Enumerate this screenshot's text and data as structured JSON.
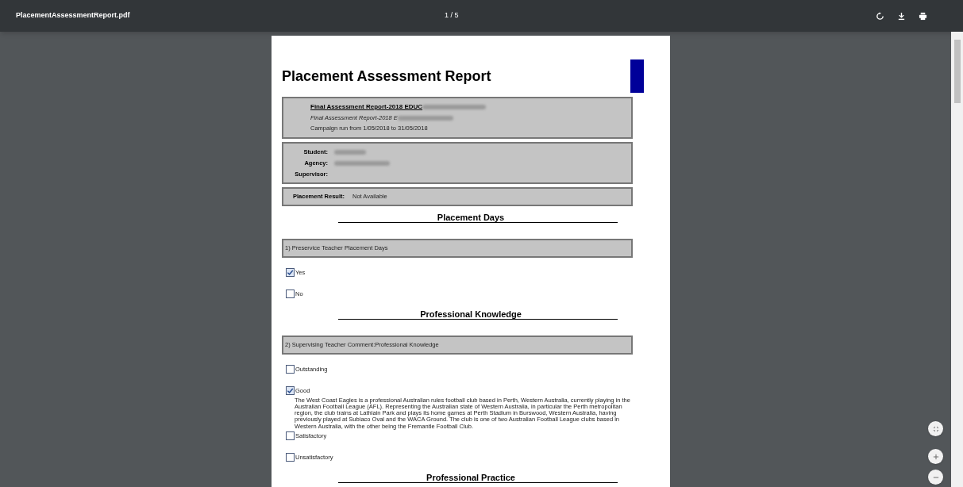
{
  "toolbar": {
    "file_name": "PlacementAssessmentReport.pdf",
    "page_indicator": "1 / 5"
  },
  "document": {
    "title": "Placement Assessment Report",
    "header_box": {
      "heading": "Final Assessment Report-2018 EDUC",
      "subtitle": "Final Assessment Report-2018 E",
      "campaign": "Campaign run from 1/05/2018 to 31/05/2018"
    },
    "details": [
      {
        "label": "Student:",
        "redacted": true
      },
      {
        "label": "Agency:",
        "redacted": true
      },
      {
        "label": "Supervisor:",
        "redacted": false
      }
    ],
    "result": {
      "label": "Placement Result:",
      "value": "Not Available"
    },
    "sections": [
      {
        "heading": "Placement Days",
        "question": "1) Preservice Teacher Placement Days",
        "options": [
          {
            "label": "Yes",
            "checked": true
          },
          {
            "label": "No",
            "checked": false
          }
        ]
      },
      {
        "heading": "Professional Knowledge",
        "question": "2) Supervising Teacher Comment:Professional Knowledge",
        "options": [
          {
            "label": "Outstanding",
            "checked": false
          },
          {
            "label": "Good",
            "checked": true,
            "comment": "The West Coast Eagles is a professional Australian rules football club based in Perth, Western Australia, currently playing in the Australian Football League (AFL). Representing the Australian state of Western Australia, in particular the Perth metropolitan region, the club trains at Lathlain Park and plays its home games at Perth Stadium in Burswood, Western Australia, having previously played at Subiaco Oval and the WACA Ground. The club is one of two Australian Football League clubs based in Western Australia, with the other being the Fremantle Football Club."
          },
          {
            "label": "Satisfactory",
            "checked": false
          },
          {
            "label": "Unsatisfactory",
            "checked": false
          }
        ]
      },
      {
        "heading": "Professional Practice"
      }
    ]
  }
}
